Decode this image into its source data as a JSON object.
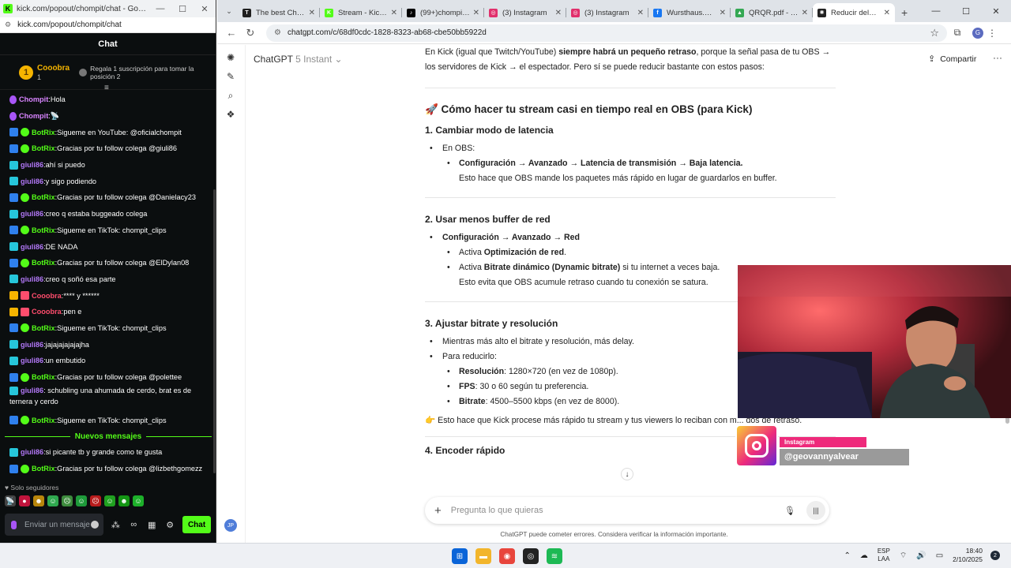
{
  "kick": {
    "window_title": "kick.com/popout/chompit/chat - Google Chr...",
    "url": "kick.com/popout/chompit/chat",
    "chat_header": "Chat",
    "pinned": {
      "user": "Cooobra",
      "count": "1",
      "gift_text": "Regala 1 suscripción para tomar la posición 2"
    },
    "messages": [
      {
        "user": "Chompit",
        "color": "#d884ff",
        "badges": [
          "mic"
        ],
        "text": " Hola"
      },
      {
        "user": "Chompit",
        "color": "#d884ff",
        "badges": [
          "mic"
        ],
        "text": " 📡"
      },
      {
        "user": "BotRix",
        "color": "#53fc18",
        "badges": [
          "bot",
          "ver"
        ],
        "text": " Sigueme en YouTube: @oficialchompit"
      },
      {
        "user": "BotRix",
        "color": "#53fc18",
        "badges": [
          "bot",
          "ver"
        ],
        "text": " Gracias por tu follow colega @giuli86"
      },
      {
        "user": "giuli86",
        "color": "#b278f7",
        "badges": [
          "sub"
        ],
        "text": " ahí si puedo"
      },
      {
        "user": "giuli86",
        "color": "#b278f7",
        "badges": [
          "sub"
        ],
        "text": " y sigo podiendo"
      },
      {
        "user": "BotRix",
        "color": "#53fc18",
        "badges": [
          "bot",
          "ver"
        ],
        "text": " Gracias por tu follow colega @Danielacy23"
      },
      {
        "user": "giuli86",
        "color": "#b278f7",
        "badges": [
          "sub"
        ],
        "text": " creo q estaba buggeado colega"
      },
      {
        "user": "BotRix",
        "color": "#53fc18",
        "badges": [
          "bot",
          "ver"
        ],
        "text": " Sigueme en TikTok: chompit_clips"
      },
      {
        "user": "giuli86",
        "color": "#b278f7",
        "badges": [
          "sub"
        ],
        "text": " DE NADA"
      },
      {
        "user": "BotRix",
        "color": "#53fc18",
        "badges": [
          "bot",
          "ver"
        ],
        "text": " Gracias por tu follow colega @ElDylan08"
      },
      {
        "user": "giuli86",
        "color": "#b278f7",
        "badges": [
          "sub"
        ],
        "text": " creo q soñó esa parte"
      },
      {
        "user": "Cooobra",
        "color": "#ff4d6d",
        "badges": [
          "crown",
          "gift"
        ],
        "text": " **** y ******"
      },
      {
        "user": "Cooobra",
        "color": "#ff4d6d",
        "badges": [
          "crown",
          "gift"
        ],
        "text": " pen e"
      },
      {
        "user": "BotRix",
        "color": "#53fc18",
        "badges": [
          "bot",
          "ver"
        ],
        "text": " Sigueme en TikTok: chompit_clips"
      },
      {
        "user": "giuli86",
        "color": "#b278f7",
        "badges": [
          "sub"
        ],
        "text": " jajajajajajajha"
      },
      {
        "user": "giuli86",
        "color": "#b278f7",
        "badges": [
          "sub"
        ],
        "text": " un embutido"
      },
      {
        "user": "BotRix",
        "color": "#53fc18",
        "badges": [
          "bot",
          "ver"
        ],
        "text": " Gracias por tu follow colega @polettee"
      },
      {
        "user": "giuli86",
        "color": "#b278f7",
        "badges": [
          "sub"
        ],
        "text": " schubling una ahumada de cerdo, brat es de ternera y cerdo",
        "wrap": true
      },
      {
        "user": "BotRix",
        "color": "#53fc18",
        "badges": [
          "bot",
          "ver"
        ],
        "text": " Sigueme en TikTok: chompit_clips"
      }
    ],
    "new_messages_label": "Nuevos mensajes",
    "new_messages": [
      {
        "user": "giuli86",
        "color": "#b278f7",
        "badges": [
          "sub"
        ],
        "text": " si picante tb y grande como te gusta"
      },
      {
        "user": "BotRix",
        "color": "#53fc18",
        "badges": [
          "bot",
          "ver"
        ],
        "text": " Gracias por tu follow colega @lizbethgomezz"
      }
    ],
    "followers_only": "Solo seguidores",
    "input_placeholder": "Enviar un mensaje",
    "send_label": "Chat"
  },
  "chrome": {
    "tabs": [
      {
        "title": "The best ChatB...",
        "fav_color": "#1f1f1f",
        "fav_text": "T"
      },
      {
        "title": "Stream - Kick Da",
        "fav_color": "#53fc18",
        "fav_text": "K"
      },
      {
        "title": "(99+)chompit_c...",
        "fav_color": "#000000",
        "fav_text": "♪"
      },
      {
        "title": "(3) Instagram",
        "fav_color": "#e1306c",
        "fav_text": "◎"
      },
      {
        "title": "(3) Instagram",
        "fav_color": "#e1306c",
        "fav_text": "◎"
      },
      {
        "title": "Wursthaus.ec |",
        "fav_color": "#1877f2",
        "fav_text": "f"
      },
      {
        "title": "QRQR.pdf - Goo",
        "fav_color": "#34a853",
        "fav_text": "▲"
      },
      {
        "title": "Reducir delay C",
        "fav_color": "#222222",
        "fav_text": "✺",
        "active": true
      }
    ],
    "url": "chatgpt.com/c/68df0cdc-1828-8323-ab68-cbe50bb5922d",
    "profile_initial": "G"
  },
  "gpt": {
    "model_name": "ChatGPT",
    "model_version": "5 Instant",
    "share_label": "Compartir",
    "intro_a": "En Kick (igual que Twitch/YouTube) ",
    "intro_b": "siempre habrá un pequeño retraso",
    "intro_c": ", porque la señal pasa de tu OBS → los servidores de Kick → el espectador. Pero sí se puede reducir bastante con estos pasos:",
    "h2": "🚀 Cómo hacer tu stream casi en tiempo real en OBS (para Kick)",
    "s1_title": "1. Cambiar modo de latencia",
    "s1_item": "En OBS:",
    "s1_path": "Configuración → Avanzado → Latencia de transmisión → Baja latencia.",
    "s1_note": "Esto hace que OBS mande los paquetes más rápido en lugar de guardarlos en buffer.",
    "s2_title": "2. Usar menos buffer de red",
    "s2_path": "Configuración → Avanzado → Red",
    "s2_a1": "Activa ",
    "s2_a2": "Optimización de red",
    "s2_a3": ".",
    "s2_b1": "Activa ",
    "s2_b2": "Bitrate dinámico (Dynamic bitrate)",
    "s2_b3": " si tu internet a veces baja.",
    "s2_note": "Esto evita que OBS acumule retraso cuando tu conexión se satura.",
    "s3_title": "3. Ajustar bitrate y resolución",
    "s3_i1": "Mientras más alto el bitrate y resolución, más delay.",
    "s3_i2": "Para reducirlo:",
    "s3_res_k": "Resolución",
    "s3_res_v": ": 1280×720 (en vez de 1080p).",
    "s3_fps_k": "FPS",
    "s3_fps_v": ": 30 o 60 según tu preferencia.",
    "s3_br_k": "Bitrate",
    "s3_br_v": ": 4500–5500 kbps (en vez de 8000).",
    "s3_tip": "👉 Esto hace que Kick procese más rápido tu stream y tus viewers lo reciban con m... dos de retraso.",
    "s4_title": "4. Encoder rápido",
    "composer_placeholder": "Pregunta lo que quieras",
    "disclaimer": "ChatGPT puede cometer errores. Considera verificar la información importante.",
    "user_initials": "JP"
  },
  "overlay": {
    "ig_label": "Instagram",
    "ig_handle": "@geovannyalvear"
  },
  "taskbar": {
    "lang_top": "ESP",
    "lang_bottom": "LAA",
    "time": "18:40",
    "date": "2/10/2025",
    "notif_count": "2"
  }
}
